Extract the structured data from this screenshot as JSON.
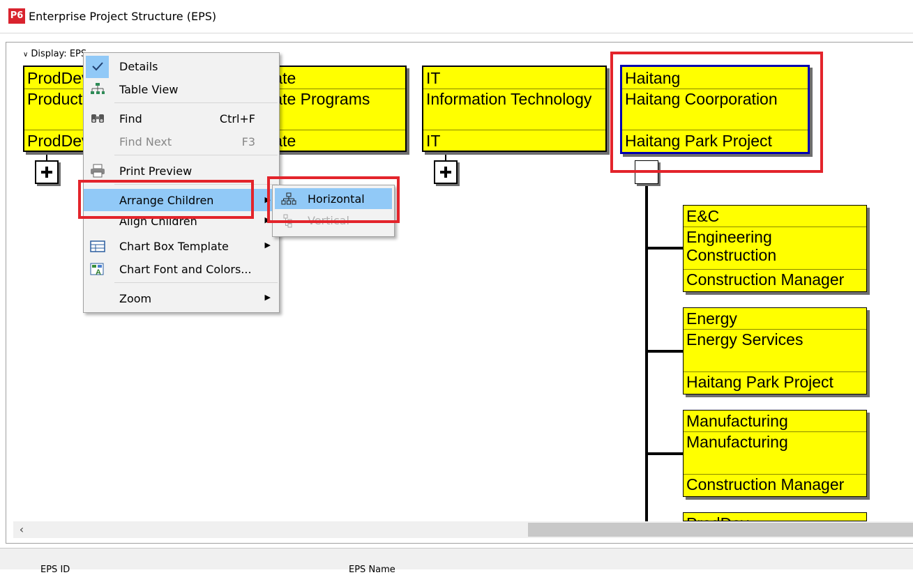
{
  "window": {
    "app_logo": "P6",
    "title": "Enterprise Project Structure (EPS)"
  },
  "display": {
    "label": "Display: EPS"
  },
  "chart_boxes": [
    {
      "id": "ProdDev",
      "name": "Product Development",
      "manager": "ProdDev"
    },
    {
      "id": "Corporate",
      "name": "Corporate Programs",
      "manager": "Corporate"
    },
    {
      "id": "IT",
      "name": "Information Technology",
      "manager": "IT"
    },
    {
      "id": "Haitang",
      "name": "Haitang Coorporation",
      "manager": "Haitang Park Project"
    }
  ],
  "child_boxes": [
    {
      "id": "E&C",
      "name": "Engineering Construction",
      "manager": "Construction Manager"
    },
    {
      "id": "Energy",
      "name": "Energy Services",
      "manager": "Haitang Park Project"
    },
    {
      "id": "Manufacturing",
      "name": "Manufacturing",
      "manager": "Construction Manager"
    },
    {
      "id": "ProdDev",
      "name": "",
      "manager": ""
    }
  ],
  "context_menu": {
    "items": [
      {
        "label": "Details",
        "checked": true
      },
      {
        "label": "Table View"
      },
      {
        "label": "Find",
        "shortcut": "Ctrl+F"
      },
      {
        "label": "Find Next",
        "shortcut": "F3",
        "disabled": true
      },
      {
        "label": "Print Preview"
      },
      {
        "label": "Arrange Children",
        "submenu": true,
        "highlighted": true
      },
      {
        "label": "Align Children",
        "submenu": true
      },
      {
        "label": "Chart Box Template",
        "submenu": true
      },
      {
        "label": "Chart Font and Colors..."
      },
      {
        "label": "Zoom",
        "submenu": true
      }
    ]
  },
  "submenu": {
    "items": [
      {
        "label": "Horizontal",
        "highlighted": true
      },
      {
        "label": "Vertical",
        "disabled": true
      }
    ]
  },
  "bottom_panel": {
    "col1": "EPS ID",
    "col2": "EPS Name"
  },
  "colors": {
    "box_fill": "#ffff00",
    "highlight": "#91c9f7",
    "annotation": "#e3242b",
    "selected_border": "#0000b0"
  }
}
